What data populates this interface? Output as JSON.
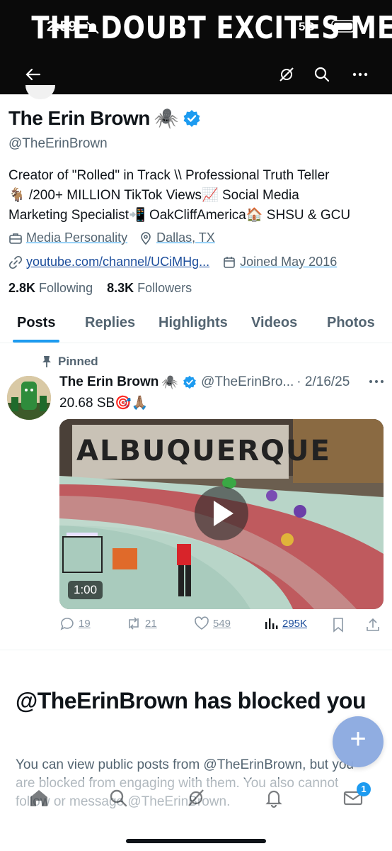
{
  "banner": {
    "text": "THE DOUBT EXCITES ME"
  },
  "status_bar": {
    "time": "2:59",
    "network": "5G"
  },
  "nav": {
    "icons": [
      "back-arrow-icon",
      "grok-icon",
      "search-icon",
      "more-icon"
    ]
  },
  "profile": {
    "name": "The Erin Brown",
    "name_emoji": "🕷️",
    "handle": "@TheErinBrown",
    "bio_line1": "Creator of \"Rolled\" in Track \\\\ Professional Truth Teller",
    "bio_line2": "🐐 /200+ MILLION TikTok Views📈 Social Media",
    "bio_line3": "Marketing Specialist📲 OakCliffAmerica🏠 SHSU & GCU",
    "category": "Media Personality",
    "location": "Dallas, TX",
    "website": "youtube.com/channel/UCiMHg...",
    "joined": "Joined May 2016",
    "following_count": "2.8K",
    "following_label": "Following",
    "followers_count": "8.3K",
    "followers_label": "Followers"
  },
  "tabs": [
    {
      "label": "Posts",
      "active": true
    },
    {
      "label": "Replies"
    },
    {
      "label": "Highlights"
    },
    {
      "label": "Videos"
    },
    {
      "label": "Photos"
    }
  ],
  "pinned_post": {
    "pinned_label": "Pinned",
    "author_name": "The Erin Brown",
    "author_emoji": "🕷️",
    "author_handle": "@TheErinBro...",
    "date": "· 2/16/25",
    "text": "20.68 SB🎯🙏🏽",
    "video_duration": "1:00",
    "video_banner": "ALBUQUERQUE",
    "replies": "19",
    "reposts": "21",
    "likes": "549",
    "views": "295K"
  },
  "blocked": {
    "title": "@TheErinBrown has blocked you",
    "body": "You can view public posts from @TheErinBrown, but you are blocked from engaging with them. You also cannot follow or message @TheErinBrown."
  },
  "fab": {
    "label": "+"
  },
  "bottom_nav": {
    "icons": [
      "home-icon",
      "search-icon",
      "grok-icon",
      "notifications-icon",
      "messages-icon"
    ],
    "messages_badge": "1"
  },
  "colors": {
    "accent": "#1d9bf0",
    "text": "#0f1419",
    "secondary": "#536471"
  }
}
